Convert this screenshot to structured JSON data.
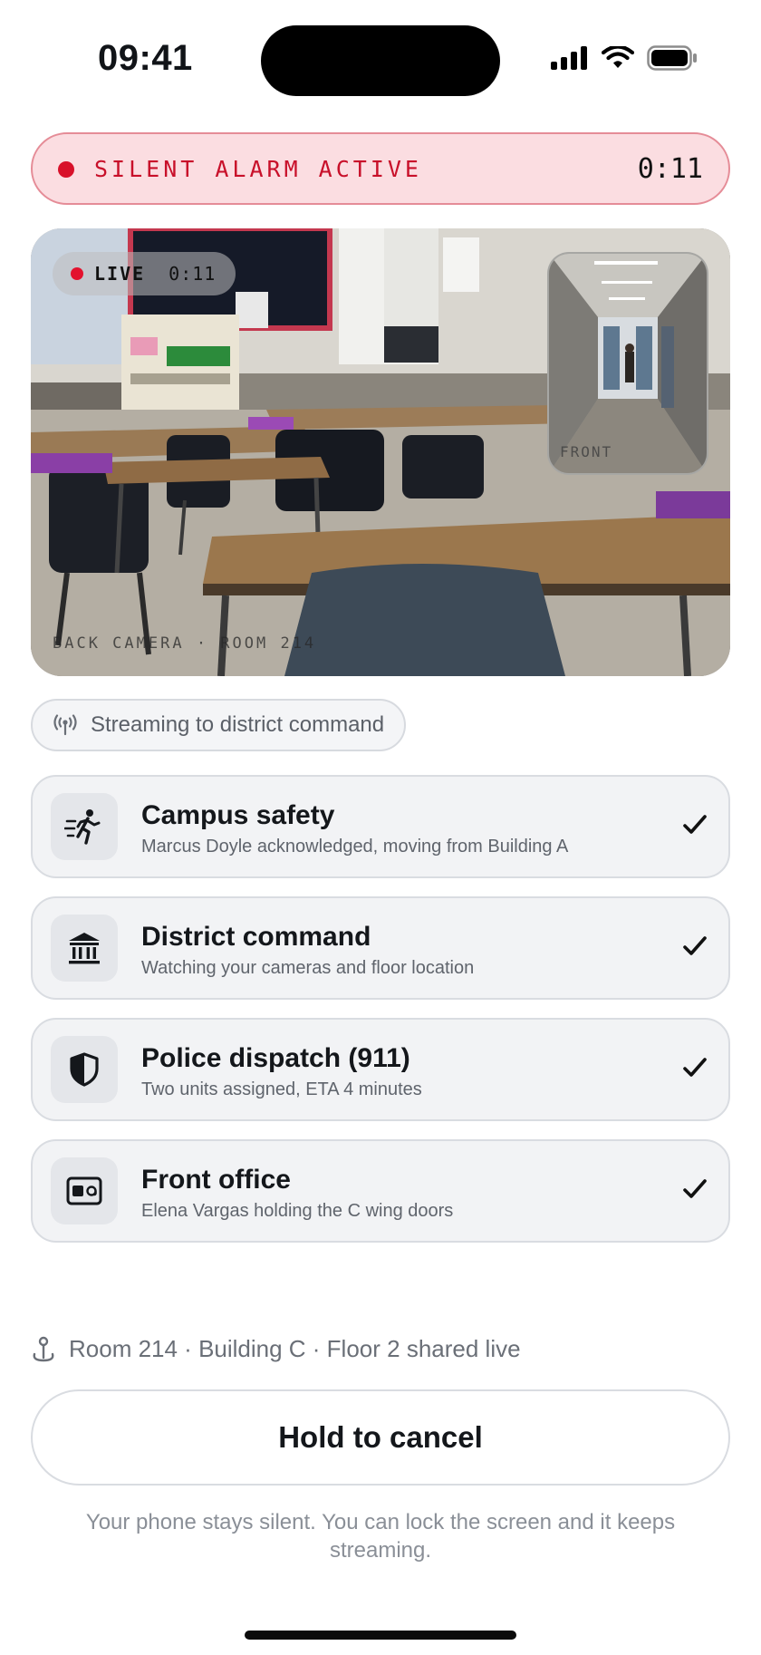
{
  "status_bar": {
    "time": "09:41",
    "icons": [
      "cellular-signal-icon",
      "wifi-icon",
      "battery-icon"
    ]
  },
  "alarm": {
    "label": "SILENT ALARM ACTIVE",
    "timer": "0:11",
    "color": "#d8112a"
  },
  "camera": {
    "live_label": "LIVE",
    "live_timer": "0:11",
    "back_label": "BACK CAMERA · ROOM 214",
    "front_label": "FRONT"
  },
  "streaming": {
    "label": "Streaming to district command",
    "icon": "broadcast-icon"
  },
  "responders": [
    {
      "icon": "running-person-icon",
      "title": "Campus safety",
      "subtitle": "Marcus Doyle acknowledged, moving from Building A",
      "status": "acknowledged"
    },
    {
      "icon": "government-building-icon",
      "title": "District command",
      "subtitle": "Watching your cameras and floor location",
      "status": "acknowledged"
    },
    {
      "icon": "shield-icon",
      "title": "Police dispatch (911)",
      "subtitle": "Two units assigned, ETA 4 minutes",
      "status": "acknowledged"
    },
    {
      "icon": "id-card-icon",
      "title": "Front office",
      "subtitle": "Elena Vargas holding the C wing doors",
      "status": "acknowledged"
    }
  ],
  "location": {
    "text": "Room 214 · Building C · Floor 2 shared live",
    "icon": "location-pin-icon"
  },
  "cancel_button": {
    "label": "Hold to cancel"
  },
  "footnote": "Your phone stays silent. You can lock the screen and it keeps streaming."
}
